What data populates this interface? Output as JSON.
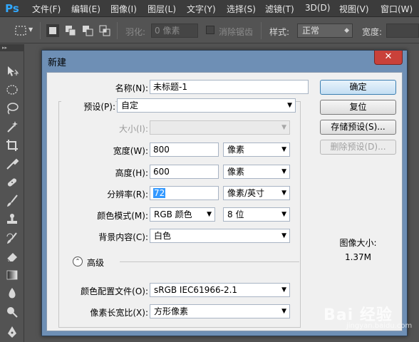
{
  "app": {
    "logo": "Ps"
  },
  "menu": [
    "文件(F)",
    "编辑(E)",
    "图像(I)",
    "图层(L)",
    "文字(Y)",
    "选择(S)",
    "滤镜(T)",
    "3D(D)",
    "视图(V)",
    "窗口(W)"
  ],
  "options": {
    "feather_label": "羽化:",
    "feather_value": "0 像素",
    "antialias_label": "消除锯齿",
    "style_label": "样式:",
    "style_value": "正常",
    "width_label": "宽度:"
  },
  "dialog": {
    "title": "新建",
    "close_label": "✕",
    "name_label": "名称(N):",
    "name_value": "未标题-1",
    "preset_label": "预设(P):",
    "preset_value": "自定",
    "size_label": "大小(I):",
    "size_value": "",
    "width_label": "宽度(W):",
    "width_value": "800",
    "width_unit": "像素",
    "height_label": "高度(H):",
    "height_value": "600",
    "height_unit": "像素",
    "resolution_label": "分辨率(R):",
    "resolution_value": "72",
    "resolution_unit": "像素/英寸",
    "color_mode_label": "颜色模式(M):",
    "color_mode_value": "RGB 颜色",
    "bit_depth_value": "8 位",
    "background_label": "背景内容(C):",
    "background_value": "白色",
    "advanced_label": "高级",
    "color_profile_label": "颜色配置文件(O):",
    "color_profile_value": "sRGB IEC61966-2.1",
    "pixel_aspect_label": "像素长宽比(X):",
    "pixel_aspect_value": "方形像素",
    "buttons": {
      "ok": "确定",
      "reset": "复位",
      "save_preset": "存储预设(S)...",
      "delete_preset": "删除预设(D)..."
    },
    "image_size_label": "图像大小:",
    "image_size_value": "1.37M"
  },
  "watermark": {
    "main": "Bai 经验",
    "sub": "jingyan.baidu.com"
  }
}
